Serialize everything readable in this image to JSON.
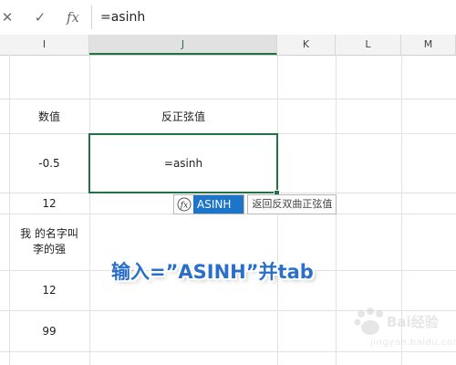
{
  "formula_bar": {
    "cancel_icon": "✕",
    "enter_icon": "✓",
    "fx_label": "fx",
    "value": "=asinh"
  },
  "columns": [
    {
      "key": "I",
      "label": "I"
    },
    {
      "key": "J",
      "label": "J"
    },
    {
      "key": "K",
      "label": "K"
    },
    {
      "key": "L",
      "label": "L"
    },
    {
      "key": "M",
      "label": "M"
    }
  ],
  "cells": {
    "i_header": "数值",
    "j_header": "反正弦值",
    "i_row2": "-0.5",
    "j_row2_editing": "=asinh",
    "i_row3": "12",
    "i_row4": "我     的名字叫\n李的强",
    "i_row5": "12",
    "i_row6": "99"
  },
  "autocomplete": {
    "icon": "fx-function-icon",
    "function_name": "ASINH",
    "tooltip": "返回反双曲正弦值"
  },
  "caption": "输入=”ASINH”并tab",
  "watermark": {
    "main": "Bai经验",
    "sub": "jingyan.baidu.com"
  },
  "colors": {
    "accent_green": "#217346",
    "selection_blue": "#1c75c8",
    "caption_blue": "#2a6fc9"
  }
}
